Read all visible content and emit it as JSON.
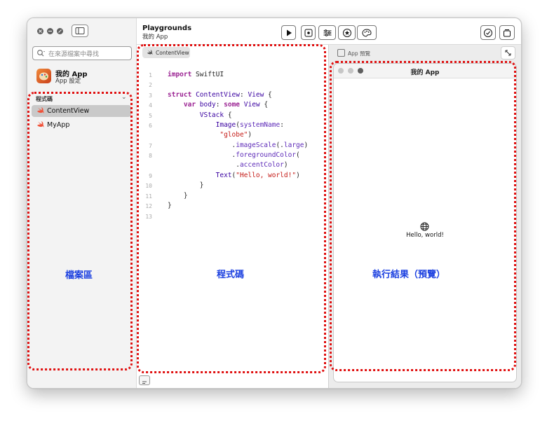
{
  "sidebar": {
    "search_placeholder": "在來源檔案中尋找",
    "app": {
      "title": "我的 App",
      "subtitle": "App 設定"
    },
    "section_title": "程式碼",
    "files": [
      {
        "name": "ContentView",
        "selected": true
      },
      {
        "name": "MyApp",
        "selected": false
      }
    ]
  },
  "toolbar": {
    "title": "Playgrounds",
    "subtitle": "我的 App",
    "buttons": [
      "play-icon",
      "stop-record-icon",
      "sliders-icon",
      "star-badge-icon",
      "palette-icon",
      "checkmark-circle-icon",
      "overlapping-windows-icon"
    ]
  },
  "editor": {
    "tab_label": "ContentView",
    "lines": [
      {
        "n": "1",
        "text": "import SwiftUI"
      },
      {
        "n": "2",
        "text": ""
      },
      {
        "n": "3",
        "text": "struct ContentView: View {"
      },
      {
        "n": "4",
        "text": "    var body: some View {"
      },
      {
        "n": "5",
        "text": "        VStack {"
      },
      {
        "n": "6",
        "text": "            Image(systemName:"
      },
      {
        "n": "",
        "text": "             \"globe\")"
      },
      {
        "n": "7",
        "text": "                .imageScale(.large)"
      },
      {
        "n": "8",
        "text": "                .foregroundColor("
      },
      {
        "n": "",
        "text": "                 .accentColor)"
      },
      {
        "n": "9",
        "text": "            Text(\"Hello, world!\")"
      },
      {
        "n": "10",
        "text": "        }"
      },
      {
        "n": "11",
        "text": "    }"
      },
      {
        "n": "12",
        "text": "}"
      },
      {
        "n": "13",
        "text": ""
      }
    ]
  },
  "preview": {
    "header_label": "App 預覽",
    "window_title": "我的 App",
    "hello_text": "Hello, world!"
  },
  "annotations": {
    "files_area": "檔案區",
    "code_area": "程式碼",
    "result_area": "執行結果（預覽）"
  },
  "colors": {
    "annotation_red": "#e01010",
    "annotation_blue": "#1a3fe0",
    "swift_orange": "#f05138"
  }
}
